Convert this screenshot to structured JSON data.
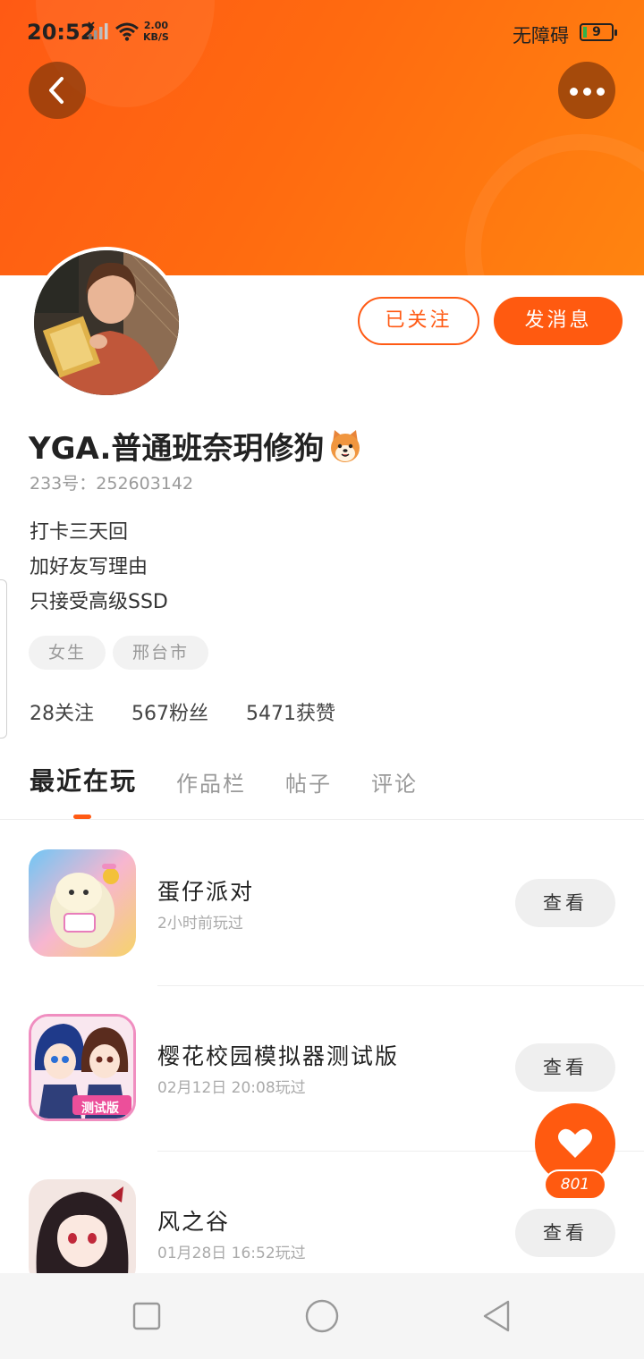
{
  "status_bar": {
    "time": "20:52",
    "speed_value": "2.00",
    "speed_unit": "KB/S",
    "accessibility": "无障碍",
    "battery": "9"
  },
  "profile": {
    "username": "YGA.普通班奈玥修狗",
    "uid_label": "233号：",
    "uid": "252603142",
    "bio": [
      "打卡三天回",
      "加好友写理由",
      "只接受高级SSD"
    ],
    "tags": [
      "女生",
      "邢台市"
    ],
    "stats": {
      "following": "28关注",
      "followers": "567粉丝",
      "likes": "5471获赞"
    }
  },
  "actions": {
    "following_label": "已关注",
    "message_label": "发消息"
  },
  "tabs": [
    "最近在玩",
    "作品栏",
    "帖子",
    "评论"
  ],
  "games": [
    {
      "name": "蛋仔派对",
      "time": "2小时前玩过",
      "button": "查看"
    },
    {
      "name": "樱花校园模拟器测试版",
      "time": "02月12日 20:08玩过",
      "button": "查看"
    },
    {
      "name": "风之谷",
      "time": "01月28日 16:52玩过",
      "button": "查看"
    }
  ],
  "game_icon_badge": "测试版",
  "fab": {
    "count": "801"
  },
  "colors": {
    "accent": "#ff5a14",
    "header_gradient_end": "#ff8410"
  }
}
